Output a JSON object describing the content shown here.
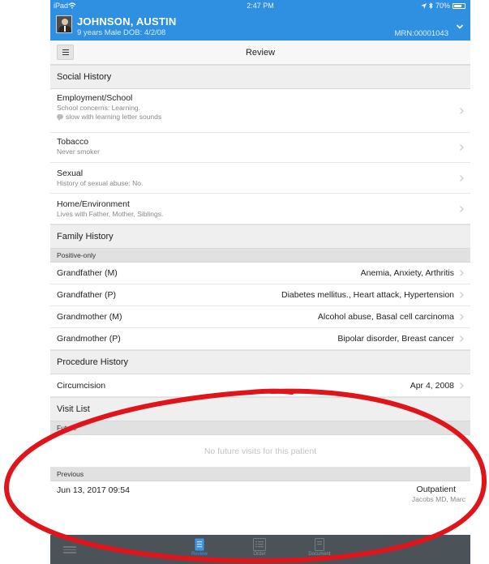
{
  "status_bar": {
    "device": "iPad",
    "time": "2:47 PM",
    "battery": "70%"
  },
  "patient": {
    "name": "JOHNSON, AUSTIN",
    "age": "9 years",
    "sex": "Male",
    "dob": "DOB: 4/2/08",
    "mrn": "MRN:00001043"
  },
  "nav": {
    "title": "Review"
  },
  "social_history": {
    "header": "Social History",
    "employment": {
      "title": "Employment/School",
      "subtitle": "School concerns: Learning.",
      "note": "slow with learning letter sounds"
    },
    "tobacco": {
      "title": "Tobacco",
      "subtitle": "Never smoker"
    },
    "sexual": {
      "title": "Sexual",
      "subtitle": "History of sexual abuse: No."
    },
    "home": {
      "title": "Home/Environment",
      "subtitle": "Lives with Father, Mother, Siblings."
    }
  },
  "family_history": {
    "header": "Family History",
    "filter": "Positive-only",
    "rows": [
      {
        "relation": "Grandfather (M)",
        "conditions": "Anemia, Anxiety, Arthritis"
      },
      {
        "relation": "Grandfather (P)",
        "conditions": "Diabetes mellitus., Heart attack, Hypertension"
      },
      {
        "relation": "Grandmother (M)",
        "conditions": "Alcohol abuse, Basal cell carcinoma"
      },
      {
        "relation": "Grandmother (P)",
        "conditions": "Bipolar disorder, Breast cancer"
      }
    ]
  },
  "procedure_history": {
    "header": "Procedure History",
    "rows": [
      {
        "name": "Circumcision",
        "date": "Apr 4, 2008"
      }
    ]
  },
  "visit_list": {
    "header": "Visit List",
    "future_label": "Future",
    "future_empty": "No future visits for this patient",
    "previous_label": "Previous",
    "previous": [
      {
        "date": "Jun 13, 2017 09:54",
        "type": "Outpatient",
        "provider": "Jacobs MD, Marc"
      }
    ]
  },
  "tabbar": {
    "tabs": [
      {
        "label": "Review",
        "icon": "review-icon",
        "active": true
      },
      {
        "label": "Order",
        "icon": "order-icon",
        "active": false
      },
      {
        "label": "Document",
        "icon": "document-icon",
        "active": false
      }
    ]
  },
  "colors": {
    "header_blue": "#2f8fe0",
    "tab_active": "#3d95e6",
    "tab_bar": "#4b5359",
    "annotation_red": "#e0141b"
  }
}
